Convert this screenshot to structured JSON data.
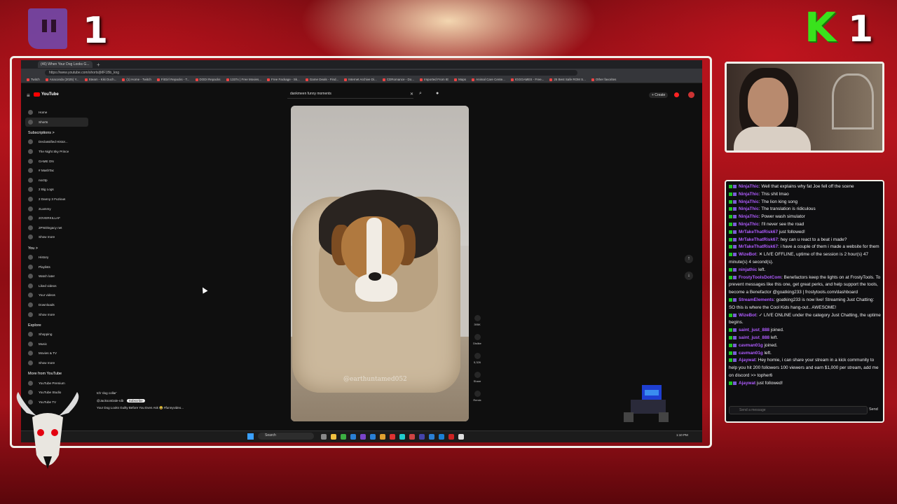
{
  "overlay": {
    "left_counter": "1",
    "right_counter": "1",
    "right_logo_letter": "K"
  },
  "browser": {
    "tab_title": "(46) When Your Dog Looks G...",
    "url": "https://www.youtube.com/shorts/jMF1Bb_kng",
    "bookmarks": [
      "Twitch",
      "Anaconda (2025) Y...",
      "Steam - Kiki Duch...",
      "(1) Home - Twitch",
      "FitGirl Repacks - T...",
      "DODI Repacks",
      "1337x | Free Movies...",
      "Free Fackage - Sk...",
      "Game Deals - Find...",
      "Internet Archive Di...",
      "CDRomance - Do...",
      "Imported From IE",
      "Maps",
      "Animal Care Cente...",
      "IGGGAMES - Free...",
      "25 Best Safe ROM S...",
      "Other favorites"
    ]
  },
  "youtube": {
    "logo": "YouTube",
    "search_value": "dankmeen funny moments",
    "create_label": "+ Create",
    "sidebar": {
      "nav": [
        {
          "label": "Home",
          "icon": "home-icon"
        },
        {
          "label": "Shorts",
          "icon": "shorts-icon",
          "active": true
        }
      ],
      "subs_header": "Subscriptions >",
      "subs": [
        "Declassified Histor...",
        "The Night Sky Prince",
        "GAME ON",
        "# MashTac",
        "nocttp",
        "2 Big Logs",
        "2 Danny 3 Fuzious",
        "2Lammy",
        "2OVERKILLAF",
        "2PNOlegacy net",
        "Show more"
      ],
      "you_header": "You >",
      "you": [
        "History",
        "Playlists",
        "Watch later",
        "Liked videos",
        "Your videos",
        "Downloads",
        "Show more"
      ],
      "explore_header": "Explore",
      "explore": [
        "Shopping",
        "Music",
        "Movies & TV",
        "Show more"
      ],
      "more_header": "More from YouTube",
      "more": [
        "YouTube Premium",
        "YouTube Studio",
        "YouTube TV"
      ]
    },
    "video": {
      "watermark": "@earthuntamed052"
    },
    "actions": [
      {
        "icon": "like-icon",
        "label": "395K"
      },
      {
        "icon": "dislike-icon",
        "label": "Dislike"
      },
      {
        "icon": "comment-icon",
        "label": "5,326"
      },
      {
        "icon": "share-icon",
        "label": "Share"
      },
      {
        "icon": "remix-icon",
        "label": "Remix"
      }
    ],
    "bottom_overlay": {
      "search_chip": "tch 'dog collar'",
      "channel": "@JacksonDale-rdb",
      "subscribe": "Subscribe",
      "title": "Your Dog Looks Guilty Before You Even Ask 😂 #funnyvideo..."
    }
  },
  "taskbar": {
    "search": "Search",
    "time": "1:10 PM"
  },
  "chat": {
    "messages": [
      {
        "user": "NinjaThic",
        "color": "#b05cff",
        "text": "Well that explains why fat Joe fell off the scene"
      },
      {
        "user": "NinjaThic",
        "color": "#b05cff",
        "text": "This shit lmao"
      },
      {
        "user": "NinjaThic",
        "color": "#b05cff",
        "text": "The lion king song"
      },
      {
        "user": "NinjaThic",
        "color": "#b05cff",
        "text": "The translation is ridiculous"
      },
      {
        "user": "NinjaThic",
        "color": "#b05cff",
        "text": "Power wash simulator"
      },
      {
        "user": "NinjaThic",
        "color": "#b05cff",
        "text": "I'll never see the road"
      },
      {
        "user": "MrTakeThatRisk67",
        "color": "#b05cff",
        "text": "just followed!",
        "plain": true
      },
      {
        "user": "MrTakeThatRisk67",
        "color": "#b05cff",
        "text": "hey can u react to a beat i made?"
      },
      {
        "user": "MrTakeThatRisk67",
        "color": "#b05cff",
        "text": "i have a couple of them i made a website for them"
      },
      {
        "user": "WizeBot",
        "color": "#b05cff",
        "text": "✕ LIVE OFFLINE, uptime of the session is 2 hour(s) 47 minute(s) 4 second(s)."
      },
      {
        "user": "ninjathic",
        "color": "#b05cff",
        "text": "left.",
        "plain": true
      },
      {
        "user": "FrostyToolsDotCom",
        "color": "#b05cff",
        "text": "Benefactors keep the lights on at FrostyTools. To prevent messages like this one, get great perks, and help support the tools, become a Benefactor @goatking233 | frostytools.com/dashboard"
      },
      {
        "user": "StreamElements",
        "color": "#b05cff",
        "text": "goatking233 is now live! Streaming Just Chatting: SO this is where the Cool Kids hang-out.. AWESOME!"
      },
      {
        "user": "WizeBot",
        "color": "#b05cff",
        "text": "✓ LIVE ONLINE under the category Just Chatting, the uptime begins."
      },
      {
        "user": "saint_just_888",
        "color": "#b05cff",
        "text": "joined.",
        "plain": true
      },
      {
        "user": "saint_just_888",
        "color": "#b05cff",
        "text": "left.",
        "plain": true
      },
      {
        "user": "cavman01g",
        "color": "#b05cff",
        "text": "joined.",
        "plain": true
      },
      {
        "user": "cavman01g",
        "color": "#b05cff",
        "text": "left.",
        "plain": true
      },
      {
        "user": "Ajaywat",
        "color": "#b05cff",
        "text": "Hey homie, i can share your stream in a kick community to help you hit 200 followers 100 viewers and earn $1,000 per stream, add me on discord >> topher6"
      },
      {
        "user": "Ajaywat",
        "color": "#b05cff",
        "text": "just followed!",
        "plain": true
      }
    ],
    "input_placeholder": "Send a message",
    "send_label": "Send"
  }
}
